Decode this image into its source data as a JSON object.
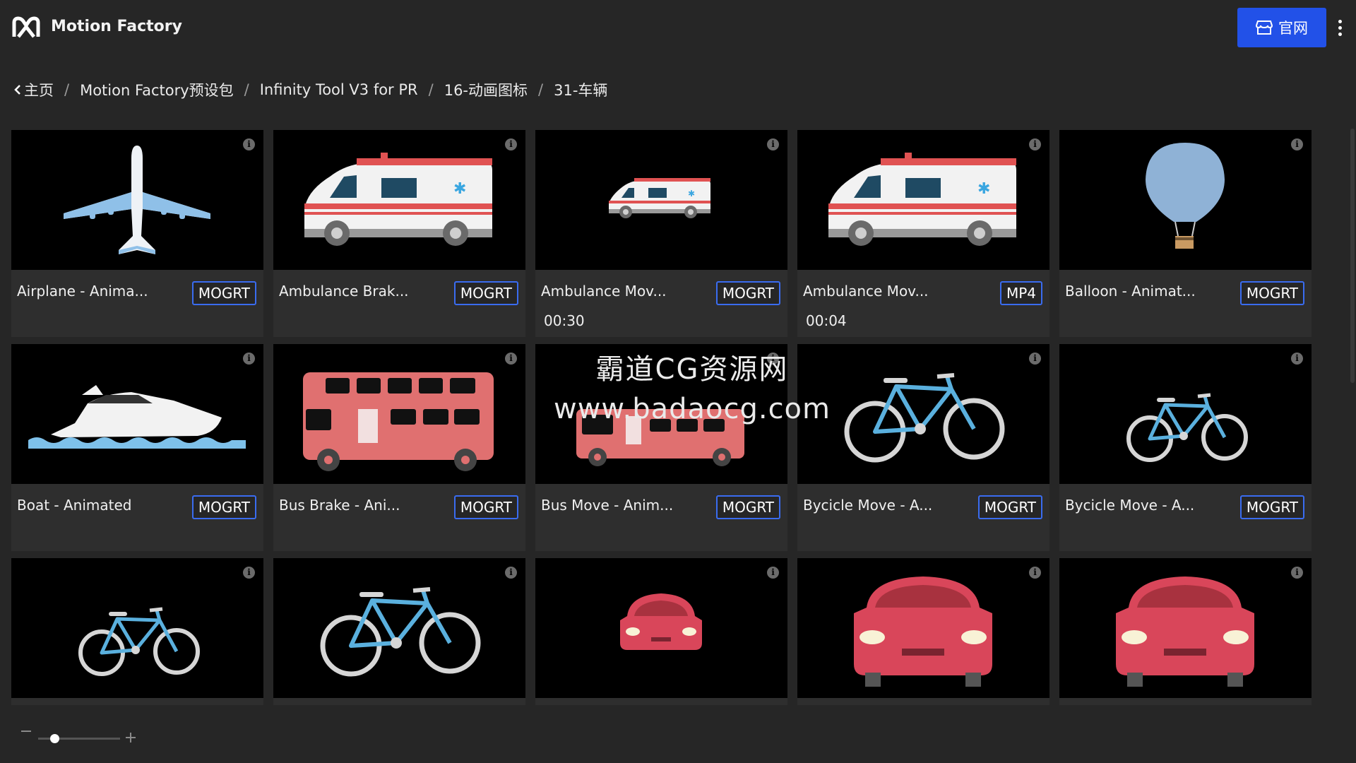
{
  "app": {
    "title": "Motion Factory",
    "logo_icon": "motion-factory-logo-icon"
  },
  "header": {
    "site_button_label": "官网",
    "site_button_icon": "storefront-icon",
    "menu_icon": "kebab-icon",
    "accent": "#2251e8"
  },
  "breadcrumb": {
    "back_icon": "chevron-left-icon",
    "items": [
      "主页",
      "Motion Factory预设包",
      "Infinity Tool V3 for PR",
      "16-动画图标",
      "31-车辆"
    ],
    "separator": "/"
  },
  "cards": [
    {
      "name": "Airplane - Anima...",
      "badge": "MOGRT",
      "duration": "",
      "thumb": "airplane"
    },
    {
      "name": "Ambulance Brak...",
      "badge": "MOGRT",
      "duration": "",
      "thumb": "ambulance-large"
    },
    {
      "name": "Ambulance Mov...",
      "badge": "MOGRT",
      "duration": "00:30",
      "thumb": "ambulance-small"
    },
    {
      "name": "Ambulance Mov...",
      "badge": "MP4",
      "duration": "00:04",
      "thumb": "ambulance-large"
    },
    {
      "name": "Balloon - Animat...",
      "badge": "MOGRT",
      "duration": "",
      "thumb": "balloon"
    },
    {
      "name": "Boat - Animated",
      "badge": "MOGRT",
      "duration": "",
      "thumb": "boat"
    },
    {
      "name": "Bus Brake - Ani...",
      "badge": "MOGRT",
      "duration": "",
      "thumb": "bus-large"
    },
    {
      "name": "Bus Move - Anim...",
      "badge": "MOGRT",
      "duration": "",
      "thumb": "bus-small"
    },
    {
      "name": "Bycicle Move - A...",
      "badge": "MOGRT",
      "duration": "",
      "thumb": "bicycle-large"
    },
    {
      "name": "Bycicle Move - A...",
      "badge": "MOGRT",
      "duration": "",
      "thumb": "bicycle-small"
    },
    {
      "name": "",
      "badge": "",
      "duration": "",
      "thumb": "bicycle-small"
    },
    {
      "name": "",
      "badge": "",
      "duration": "",
      "thumb": "bicycle-large"
    },
    {
      "name": "",
      "badge": "",
      "duration": "",
      "thumb": "car-small"
    },
    {
      "name": "",
      "badge": "",
      "duration": "",
      "thumb": "car-large"
    },
    {
      "name": "",
      "badge": "",
      "duration": "",
      "thumb": "car-large"
    }
  ],
  "watermark": {
    "line1": "霸道CG资源网",
    "line2": "www.badaocg.com"
  },
  "zoom": {
    "level": 0.2,
    "minus_icon": "minus-icon",
    "plus_icon": "plus-icon"
  }
}
